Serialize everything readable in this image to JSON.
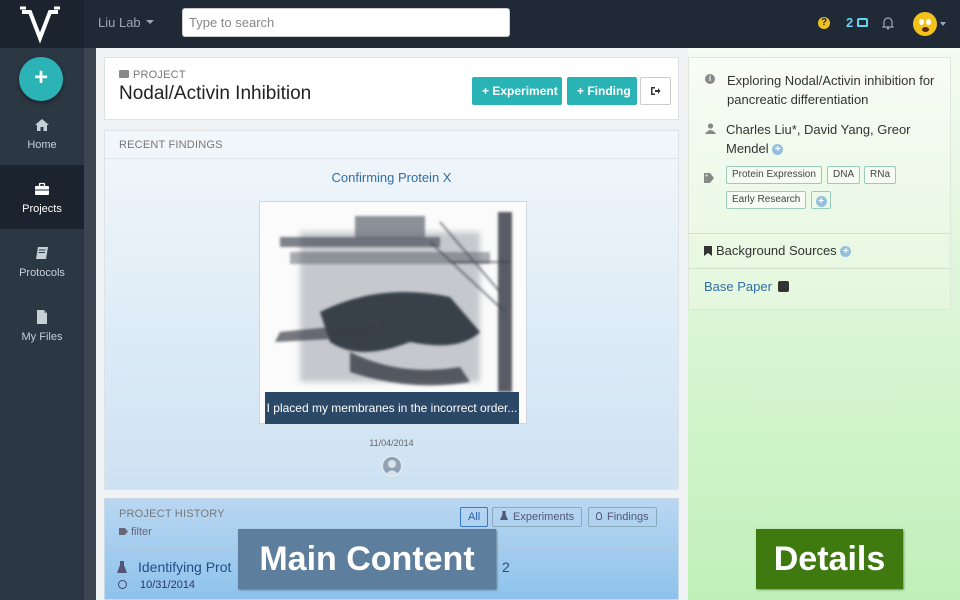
{
  "topbar": {
    "lab_name": "Liu Lab",
    "search_placeholder": "Type to search",
    "help_glyph": "?",
    "inbox_count": "2"
  },
  "sidebar": {
    "add_glyph": "+",
    "items": [
      {
        "label": "Home",
        "icon": "home-icon",
        "active": false
      },
      {
        "label": "Projects",
        "icon": "briefcase-icon",
        "active": true
      },
      {
        "label": "Protocols",
        "icon": "book-icon",
        "active": false
      },
      {
        "label": "My Files",
        "icon": "file-icon",
        "active": false
      }
    ]
  },
  "project": {
    "kicker": "PROJECT",
    "title": "Nodal/Activin Inhibition",
    "experiment_button": "+ Experiment",
    "finding_button": "+ Finding"
  },
  "findings": {
    "section_title": "RECENT FINDINGS",
    "title": "Confirming Protein X",
    "caption": "I placed my membranes in the incorrect order...",
    "date": "11/04/2014"
  },
  "history": {
    "section_title": "PROJECT HISTORY",
    "filter": "filter",
    "tabs": [
      "All",
      "Experiments",
      "Findings"
    ],
    "item_title": "Identifying Prot",
    "item_title_tail": "2",
    "item_date": "10/31/2014"
  },
  "details": {
    "description": "Exploring Nodal/Activin inhibition for pancreatic differentiation",
    "authors": "Charles Liu*, David Yang, Greor Mendel",
    "tags": [
      "Protein Expression",
      "DNA",
      "RNa",
      "Early Research"
    ],
    "background_sources": "Background Sources",
    "base_paper": "Base Paper"
  },
  "overlays": {
    "main": "Main Content",
    "details": "Details"
  },
  "colors": {
    "topbar": "#1f2a36",
    "sidebar": "#2c3744",
    "teal": "#2ab3b5",
    "link": "#2f6fa8",
    "main_overlay": "#5d7e9c",
    "details_overlay": "#3f7a10"
  }
}
